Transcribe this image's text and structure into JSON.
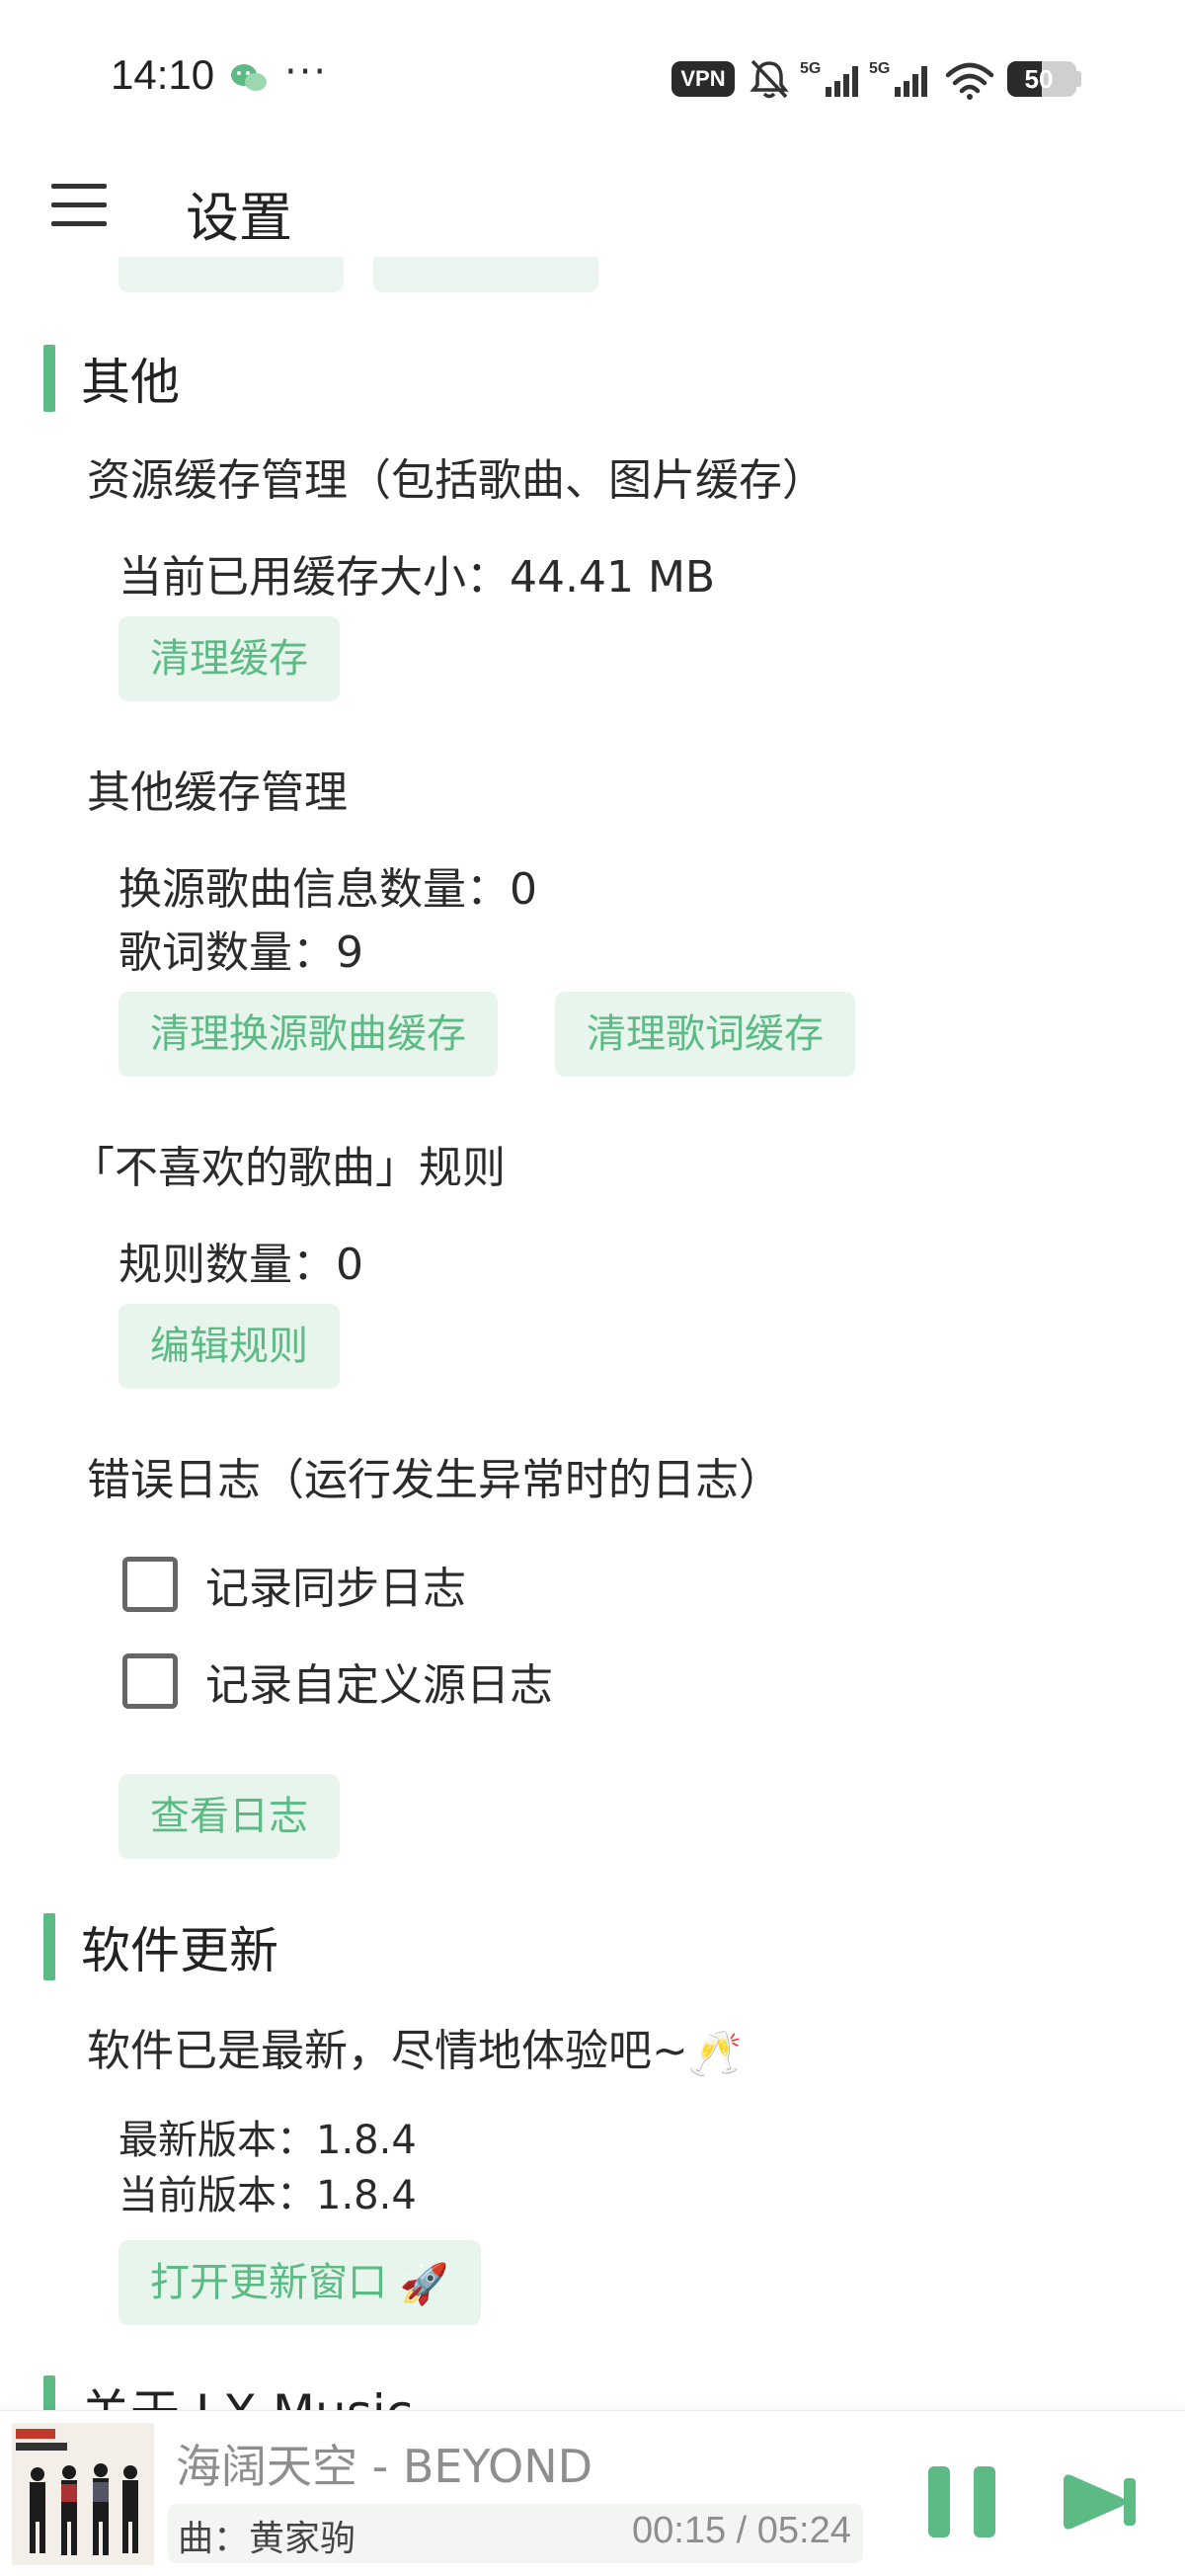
{
  "status_bar": {
    "time": "14:10",
    "dots": "···",
    "vpn": "VPN",
    "battery": "50",
    "battery_level_percent": 50
  },
  "header": {
    "title": "设置"
  },
  "other": {
    "title": "其他",
    "cache": {
      "title": "资源缓存管理（包括歌曲、图片缓存）",
      "size_text": "当前已用缓存大小：44.41 MB",
      "clear_button": "清理缓存"
    },
    "other_cache": {
      "title": "其他缓存管理",
      "source_count": "换源歌曲信息数量：0",
      "lyric_count": "歌词数量：9",
      "clear_source_button": "清理换源歌曲缓存",
      "clear_lyric_button": "清理歌词缓存"
    },
    "dislike": {
      "title": "「不喜欢的歌曲」规则",
      "rule_count": "规则数量：0",
      "edit_button": "编辑规则"
    },
    "error_log": {
      "title": "错误日志（运行发生异常时的日志）",
      "sync_log": "记录同步日志",
      "custom_source_log": "记录自定义源日志",
      "view_button": "查看日志"
    }
  },
  "update": {
    "title": "软件更新",
    "status": "软件已是最新，尽情地体验吧~",
    "status_emoji": "🥂",
    "latest_version": "最新版本：1.8.4",
    "current_version": "当前版本：1.8.4",
    "open_button": "打开更新窗口",
    "open_button_emoji": "🚀"
  },
  "about": {
    "title": "关于 LX Music"
  },
  "player": {
    "song": "海阔天空 - BEYOND",
    "lyric": "曲：黄家驹",
    "time": "00:15 / 05:24"
  },
  "colors": {
    "accent": "#5cba85",
    "button_bg": "#e8f5ed"
  }
}
